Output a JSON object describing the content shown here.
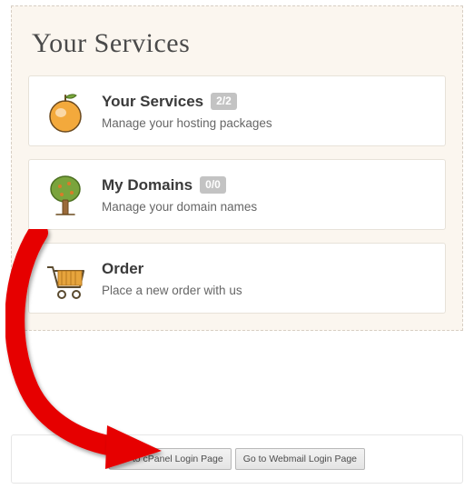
{
  "panel": {
    "title": "Your Services",
    "cards": [
      {
        "title": "Your Services",
        "badge": "2/2",
        "subtitle": "Manage your hosting packages"
      },
      {
        "title": "My Domains",
        "badge": "0/0",
        "subtitle": "Manage your domain names"
      },
      {
        "title": "Order",
        "badge": "",
        "subtitle": "Place a new order with us"
      }
    ]
  },
  "buttons": {
    "cpanel": "Go to cPanel Login Page",
    "webmail": "Go to Webmail Login Page"
  },
  "annotation": {
    "type": "arrow",
    "color": "#e60000",
    "target": "cpanel-button"
  }
}
